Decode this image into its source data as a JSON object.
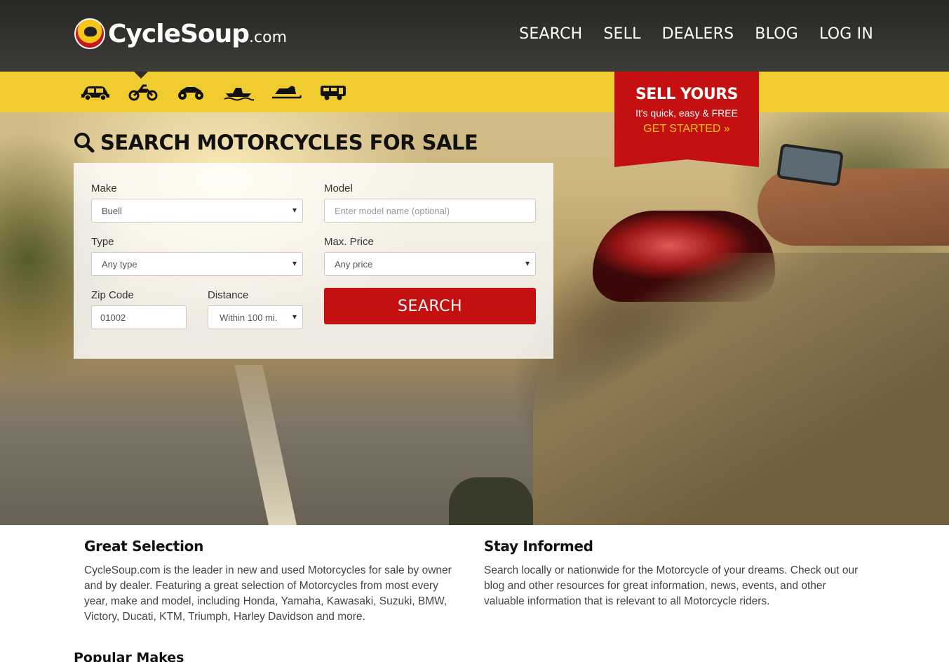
{
  "brand": {
    "name": "CycleSoup",
    "suffix": ".com"
  },
  "nav": [
    {
      "label": "SEARCH"
    },
    {
      "label": "SELL"
    },
    {
      "label": "DEALERS"
    },
    {
      "label": "BLOG"
    },
    {
      "label": "LOG IN"
    }
  ],
  "vehicle_types": [
    "car-icon",
    "motorcycle-icon",
    "atv-icon",
    "boat-icon",
    "snowmobile-icon",
    "rv-icon"
  ],
  "sell_badge": {
    "title": "SELL YOURS",
    "subtitle": "It's quick, easy & FREE",
    "cta": "GET STARTED »"
  },
  "search": {
    "title": "SEARCH MOTORCYCLES FOR SALE",
    "make_label": "Make",
    "make_value": "Buell",
    "model_label": "Model",
    "model_placeholder": "Enter model name (optional)",
    "type_label": "Type",
    "type_value": "Any type",
    "price_label": "Max. Price",
    "price_value": "Any price",
    "zip_label": "Zip Code",
    "zip_value": "01002",
    "distance_label": "Distance",
    "distance_value": "Within 100 mi.",
    "button": "SEARCH"
  },
  "info": {
    "left": {
      "title": "Great Selection",
      "body": "CycleSoup.com is the leader in new and used Motorcycles for sale by owner and by dealer. Featuring a great selection of Motorcycles from most every year, make and model, including Honda, Yamaha, Kawasaki, Suzuki, BMW, Victory, Ducati, KTM, Triumph, Harley Davidson and more."
    },
    "right": {
      "title": "Stay Informed",
      "body": "Search locally or nationwide for the Motorcycle of your dreams. Check out our blog and other resources for great information, news, events, and other valuable information that is relevant to all Motorcycle riders."
    }
  },
  "popular_makes_title": "Popular Makes",
  "colors": {
    "brand_yellow": "#f0cc2e",
    "brand_red": "#c41010",
    "header_dark": "#2d2d2d"
  }
}
